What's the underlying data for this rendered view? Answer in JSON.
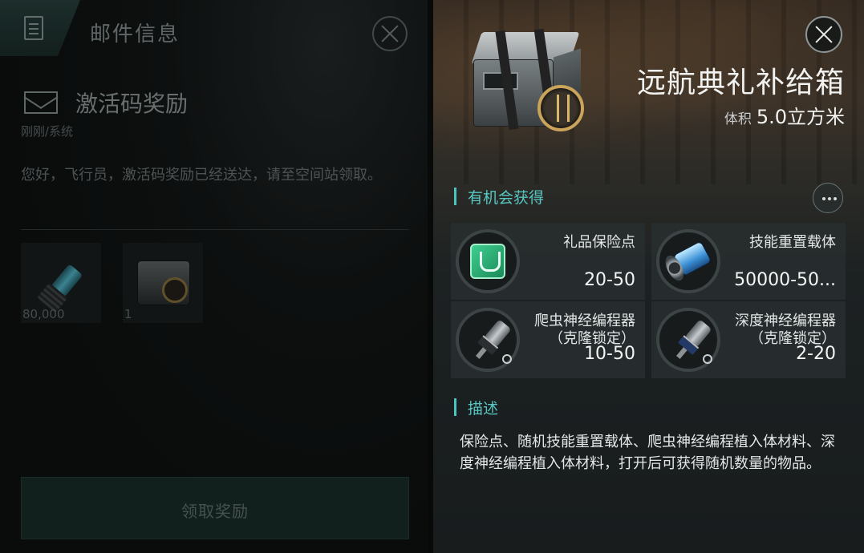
{
  "mail_panel": {
    "title": "邮件信息",
    "subject": "激活码奖励",
    "meta": "刚刚/系统",
    "body": "您好，飞行员，激活码奖励已经送达，请至空间站领取。",
    "attachments": [
      {
        "icon": "skill-reset-carrier-icon",
        "qty": "80,000"
      },
      {
        "icon": "supply-box-icon",
        "qty": "1"
      }
    ],
    "claim_button": "领取奖励"
  },
  "item_panel": {
    "name": "远航典礼补给箱",
    "volume_label": "体积",
    "volume_value": "5.0立方米",
    "section_rewards": "有机会获得",
    "rewards": [
      {
        "name": "礼品保险点",
        "range": "20-50",
        "icon": "gift-insurance-icon"
      },
      {
        "name": "技能重置载体",
        "range": "50000-50...",
        "icon": "skill-reset-carrier-icon"
      },
      {
        "name": "爬虫神经编程器\n（克隆锁定）",
        "range": "10-50",
        "icon": "crawler-neural-programmer-icon"
      },
      {
        "name": "深度神经编程器\n（克隆锁定）",
        "range": "2-20",
        "icon": "deep-neural-programmer-icon"
      }
    ],
    "section_desc": "描述",
    "description": "保险点、随机技能重置载体、爬虫神经编程植入体材料、深度神经编程植入体材料，打开后可获得随机数量的物品。"
  },
  "colors": {
    "accent": "#58c6c2",
    "claim_button": "#1d3430",
    "text_primary": "#f2f2f0"
  }
}
